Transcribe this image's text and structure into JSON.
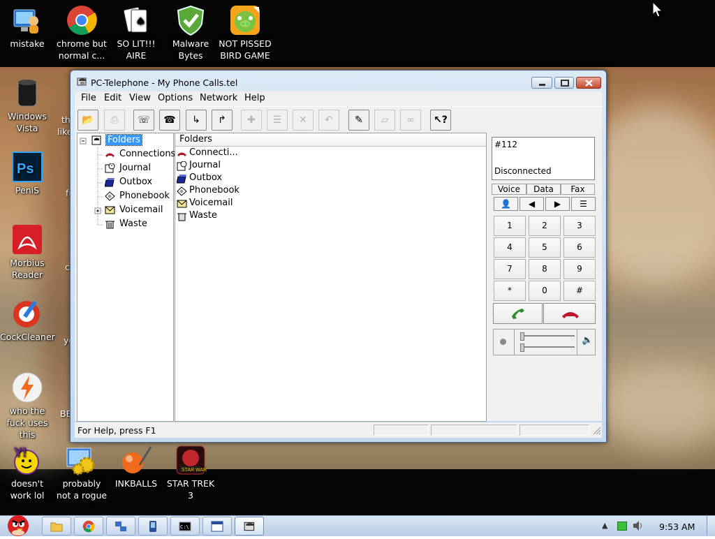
{
  "desktop": {
    "icons": [
      {
        "id": "mistake",
        "label": "mistake",
        "icon": "computer-user-icon"
      },
      {
        "id": "chrome",
        "label": "chrome but normal c...",
        "icon": "chrome-icon"
      },
      {
        "id": "solitaire",
        "label": "SO LIT!!! AIRE",
        "icon": "playing-cards-icon"
      },
      {
        "id": "malware",
        "label": "Malware Bytes",
        "icon": "shield-check-icon"
      },
      {
        "id": "pissed-bird",
        "label": "NOT PISSED BIRD GAME",
        "icon": "green-pig-icon"
      },
      {
        "id": "windows-vista",
        "label": "Windows Vista",
        "icon": "trash-bin-icon"
      },
      {
        "id": "penis",
        "label": "PeniS",
        "icon": "photoshop-icon"
      },
      {
        "id": "morbius",
        "label": "Morbius Reader",
        "icon": "pdf-reader-icon"
      },
      {
        "id": "cockcleaner",
        "label": "CockCleaner",
        "icon": "ccleaner-icon"
      },
      {
        "id": "who-uses",
        "label": "who the fuck uses this",
        "icon": "lightning-icon"
      },
      {
        "id": "yahoo",
        "label": "doesn't work lol",
        "icon": "yahoo-messenger-icon"
      },
      {
        "id": "rogue",
        "label": "probably not a rogue",
        "icon": "gears-computer-icon"
      },
      {
        "id": "inkballs",
        "label": "INKBALLS",
        "icon": "ink-ball-icon"
      },
      {
        "id": "startrek",
        "label": "STAR TREK 3",
        "icon": "star-wars-birds-icon"
      }
    ],
    "partial_labels": [
      "th",
      "like",
      "fu",
      "c",
      "yo",
      "BE"
    ]
  },
  "window": {
    "title": "PC-Telephone - My Phone Calls.tel",
    "menu": [
      "File",
      "Edit",
      "View",
      "Options",
      "Network",
      "Help"
    ],
    "toolbar": [
      {
        "name": "open-folder",
        "enabled": true,
        "icon": "folder-open-icon"
      },
      {
        "name": "print",
        "enabled": false,
        "icon": "printer-icon"
      },
      {
        "name": "answer-a",
        "enabled": true,
        "icon": "phone-a-icon"
      },
      {
        "name": "dial",
        "enabled": true,
        "icon": "phone-dial-icon"
      },
      {
        "name": "forward-f",
        "enabled": true,
        "icon": "forward-f-icon"
      },
      {
        "name": "transfer-t",
        "enabled": true,
        "icon": "transfer-t-icon"
      },
      {
        "name": "add",
        "enabled": false,
        "icon": "plus-icon"
      },
      {
        "name": "list",
        "enabled": false,
        "icon": "list-icon"
      },
      {
        "name": "delete",
        "enabled": false,
        "icon": "x-icon"
      },
      {
        "name": "undo",
        "enabled": false,
        "icon": "undo-icon"
      },
      {
        "name": "phonebook",
        "enabled": true,
        "icon": "phonebook-icon"
      },
      {
        "name": "eraser",
        "enabled": false,
        "icon": "eraser-icon"
      },
      {
        "name": "link",
        "enabled": false,
        "icon": "link-icon"
      },
      {
        "name": "help",
        "enabled": true,
        "icon": "help-cursor-icon"
      }
    ],
    "tree": {
      "root": "Folders",
      "items": [
        "Connections",
        "Journal",
        "Outbox",
        "Phonebook",
        "Voicemail",
        "Waste"
      ]
    },
    "list": {
      "header": "Folders",
      "items": [
        "Connecti...",
        "Journal",
        "Outbox",
        "Phonebook",
        "Voicemail",
        "Waste"
      ]
    },
    "phone": {
      "number": "#112",
      "status": "Disconnected",
      "modes": [
        "Voice",
        "Data",
        "Fax"
      ],
      "keys": [
        "1",
        "2",
        "3",
        "4",
        "5",
        "6",
        "7",
        "8",
        "9",
        "*",
        "0",
        "#"
      ]
    },
    "statusbar": "For Help, press F1"
  },
  "taskbar": {
    "clock": "9:53 AM"
  }
}
